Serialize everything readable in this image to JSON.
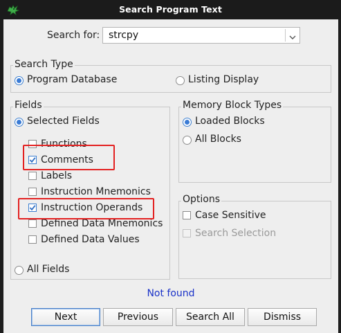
{
  "window": {
    "title": "Search Program Text"
  },
  "search": {
    "label": "Search for:",
    "value": "strcpy"
  },
  "search_type": {
    "title": "Search Type",
    "options": [
      {
        "label": "Program Database",
        "selected": true
      },
      {
        "label": "Listing Display",
        "selected": false
      }
    ]
  },
  "fields": {
    "title": "Fields",
    "selected_fields_label": "Selected Fields",
    "all_fields_label": "All Fields",
    "mode": "selected",
    "items": [
      {
        "label": "Functions",
        "checked": false
      },
      {
        "label": "Comments",
        "checked": true
      },
      {
        "label": "Labels",
        "checked": false
      },
      {
        "label": "Instruction Mnemonics",
        "checked": false
      },
      {
        "label": "Instruction Operands",
        "checked": true
      },
      {
        "label": "Defined Data Mnemonics",
        "checked": false
      },
      {
        "label": "Defined Data Values",
        "checked": false
      }
    ]
  },
  "memory_block_types": {
    "title": "Memory Block Types",
    "options": [
      {
        "label": "Loaded Blocks",
        "selected": true
      },
      {
        "label": "All Blocks",
        "selected": false
      }
    ]
  },
  "options": {
    "title": "Options",
    "items": [
      {
        "label": "Case Sensitive",
        "checked": false,
        "enabled": true
      },
      {
        "label": "Search Selection",
        "checked": false,
        "enabled": false
      }
    ]
  },
  "status": {
    "text": "Not found",
    "color": "#1a32c8"
  },
  "buttons": {
    "next": "Next",
    "previous": "Previous",
    "search_all": "Search All",
    "dismiss": "Dismiss"
  },
  "colors": {
    "accent": "#3a7bd5",
    "highlight": "#e32020",
    "titlebar": "#1b1b1b"
  },
  "icons": {
    "app": "dragon-icon"
  }
}
